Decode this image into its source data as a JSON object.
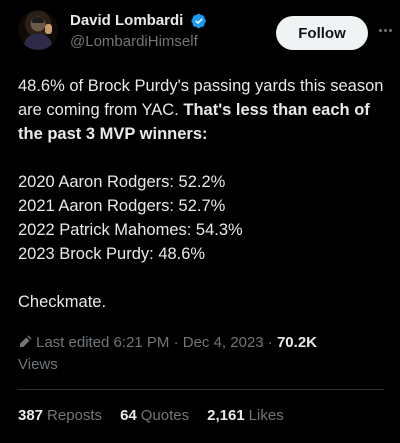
{
  "author": {
    "display_name": "David Lombardi",
    "handle": "@LombardiHimself",
    "verified": true,
    "follow_label": "Follow"
  },
  "tweet": {
    "intro_plain": "48.6% of Brock Purdy's passing yards this season are coming from YAC. ",
    "intro_bold": "That's less than each of the past 3 MVP winners:",
    "lines": [
      "2020 Aaron Rodgers: 52.2%",
      "2021 Aaron Rodgers: 52.7%",
      "2022 Patrick Mahomes: 54.3%",
      "2023 Brock Purdy: 48.6%"
    ],
    "closing": "Checkmate."
  },
  "meta": {
    "edited_label": "Last edited 6:21 PM · Dec 4, 2023 · ",
    "views_count": "70.2K",
    "views_label": "Views"
  },
  "stats": {
    "reposts_count": "387",
    "reposts_label": "Reposts",
    "quotes_count": "64",
    "quotes_label": "Quotes",
    "likes_count": "2,161",
    "likes_label": "Likes"
  },
  "colors": {
    "background": "#000000",
    "text": "#e7e9ea",
    "muted": "#71767b",
    "verified_badge": "#1d9bf0",
    "follow_button_bg": "#eff3f4"
  },
  "icons": {
    "verified": "verified-badge-icon",
    "more": "more-horizontal-icon",
    "edit": "pencil-icon"
  }
}
